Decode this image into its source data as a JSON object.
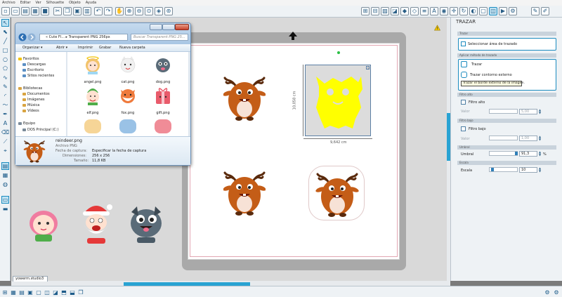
{
  "menu": [
    "Archivo",
    "Editar",
    "Ver",
    "Silhouette",
    "Objeto",
    "Ayuda"
  ],
  "explorer": {
    "address": "« Cute Fl... ▸ Transparent PNG 256px",
    "search_placeholder": "Buscar Transparent PNG 25...",
    "commands": [
      "Organizar ▾",
      "Abrir ▾",
      "Imprimir",
      "Grabar",
      "Nueva carpeta"
    ],
    "nav": {
      "favorites": "Favoritos",
      "fav_items": [
        "Descargas",
        "Escritorio",
        "Sitios recientes"
      ],
      "libraries": "Bibliotecas",
      "lib_items": [
        "Documentos",
        "Imágenes",
        "Música",
        "Vídeos"
      ],
      "computer": "Equipo",
      "comp_items": [
        "DOS Principal (C:)"
      ]
    },
    "files": [
      {
        "name": "angel.png",
        "icon": "elf-angel-icon",
        "color": "#f2c36b"
      },
      {
        "name": "cat.png",
        "icon": "cat-icon",
        "color": "#f1f1f1"
      },
      {
        "name": "dog.png",
        "icon": "dog-icon",
        "color": "#5a6b78"
      },
      {
        "name": "elf.png",
        "icon": "elf-icon",
        "color": "#4fae4a"
      },
      {
        "name": "fox.png",
        "icon": "fox-icon",
        "color": "#ef7a3c"
      },
      {
        "name": "gift.png",
        "icon": "gift-icon",
        "color": "#e95b6b"
      }
    ],
    "detail": {
      "filename": "reindeer.png",
      "filetype": "Archivo PNG",
      "rows": [
        {
          "label": "Fecha de captura:",
          "value": "Especificar la fecha de captura"
        },
        {
          "label": "Dimensiones:",
          "value": "256 x 256"
        },
        {
          "label": "Tamaño:",
          "value": "11,8 KB"
        }
      ]
    }
  },
  "canvas": {
    "width_label": "9,642 cm",
    "height_label": "10,058 cm",
    "trace_fill": "#ffff00",
    "reindeer_color": "#c45d17"
  },
  "panel": {
    "title": "TRAZAR",
    "sec_area": "Trazar",
    "area_button": "Seleccionar área de trazado",
    "sec_method": "Aplicar método de trazado",
    "btn_trace": "Trazar",
    "btn_outer": "Trazar contorno externo",
    "tooltip": "Trazar el borde externo de la imagen.",
    "sec_highpass": "Filtro alto",
    "highpass_check": "Filtro alto",
    "freq_label": "Valor",
    "highpass_value": "5,00",
    "sec_lowpass": "Filtro bajo",
    "lowpass_check": "Filtro bajo",
    "lowpass_value": "1,00",
    "sec_threshold": "Umbral",
    "threshold_label": "Umbral",
    "threshold_value": "91,3",
    "threshold_unit": "%",
    "sec_scale": "Escala",
    "scale_label": "Escala",
    "scale_value": "10"
  },
  "tab": {
    "label": "yowerm.studio3"
  },
  "accent": "#1b8bbf"
}
